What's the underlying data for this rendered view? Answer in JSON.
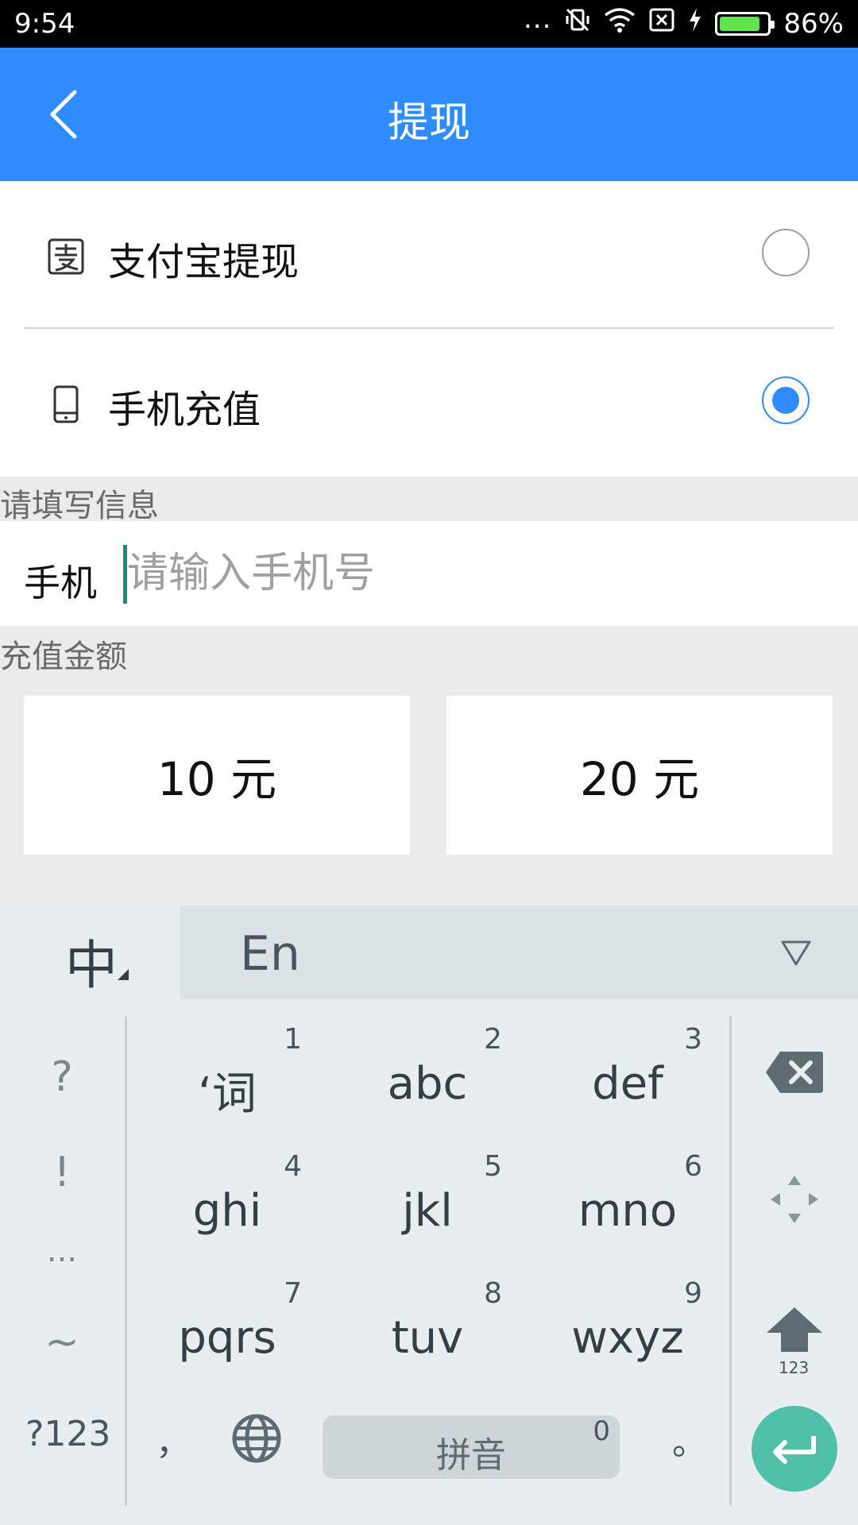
{
  "status_bar": {
    "time": "9:54",
    "dots": "...",
    "battery_percent": "86%",
    "battery_level": 0.86
  },
  "app_bar": {
    "title": "提现",
    "back_icon": "chevron-left-icon"
  },
  "options": [
    {
      "label": "支付宝提现",
      "icon": "alipay-icon",
      "selected": false
    },
    {
      "label": "手机充值",
      "icon": "phone-icon",
      "selected": true
    }
  ],
  "form": {
    "info_section_label": "请填写信息",
    "phone_label": "手机",
    "phone_placeholder": "请输入手机号",
    "phone_value": "",
    "amount_section_label": "充值金额",
    "amounts": [
      "10 元",
      "20 元"
    ]
  },
  "keyboard": {
    "mode_zh": "中",
    "mode_en": "En",
    "symbols": [
      "?",
      "!",
      "...",
      "~"
    ],
    "keys": [
      {
        "label": "‘词",
        "num": "1"
      },
      {
        "label": "abc",
        "num": "2"
      },
      {
        "label": "def",
        "num": "3"
      },
      {
        "label": "ghi",
        "num": "4"
      },
      {
        "label": "jkl",
        "num": "5"
      },
      {
        "label": "mno",
        "num": "6"
      },
      {
        "label": "pqrs",
        "num": "7"
      },
      {
        "label": "tuv",
        "num": "8"
      },
      {
        "label": "wxyz",
        "num": "9"
      }
    ],
    "shift_sublabel": "123",
    "bottom": {
      "num_switch": "?123",
      "comma": "，",
      "globe_icon": "globe-icon",
      "space_label": "拼音",
      "space_num": "0",
      "period": "。"
    }
  },
  "colors": {
    "accent": "#2f8cff",
    "enter": "#4fbfa8",
    "cursor": "#1d8c7c"
  }
}
